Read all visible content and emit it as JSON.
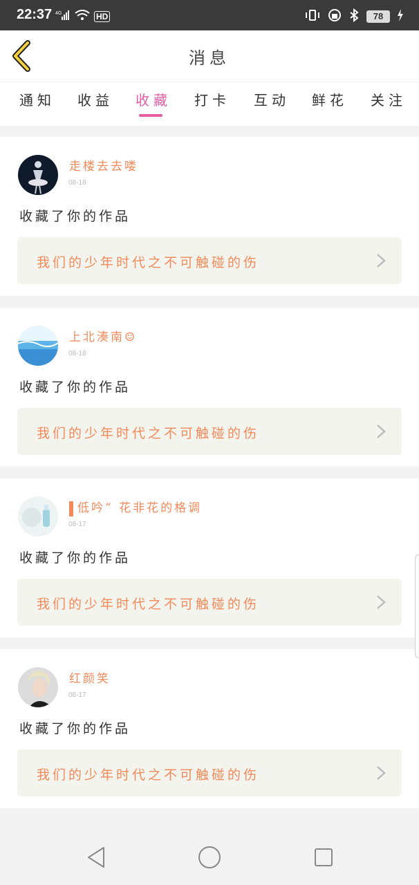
{
  "status": {
    "time": "22:37",
    "network": "4G",
    "hd": "HD",
    "battery": "78"
  },
  "header": {
    "title": "消息",
    "back_icon": "chevron-left-icon"
  },
  "tabs": [
    {
      "label": "通知",
      "active": false
    },
    {
      "label": "收益",
      "active": false
    },
    {
      "label": "收藏",
      "active": true
    },
    {
      "label": "打卡",
      "active": false
    },
    {
      "label": "互动",
      "active": false
    },
    {
      "label": "鲜花",
      "active": false
    },
    {
      "label": "关注",
      "active": false
    }
  ],
  "colors": {
    "accent": "#e55ea0",
    "name": "#f28a5a",
    "work_bg": "#f4f4ee"
  },
  "items": [
    {
      "name": "走楼去去喽",
      "date": "08-18",
      "action": "收藏了你的作品",
      "work": "我们的少年时代之不可触碰的伤"
    },
    {
      "name": "上北湊南☺",
      "date": "08-18",
      "action": "收藏了你的作品",
      "work": "我们的少年时代之不可触碰的伤"
    },
    {
      "name": "低吟” 花非花的格调",
      "date": "08-17",
      "action": "收藏了你的作品",
      "work": "我们的少年时代之不可触碰的伤"
    },
    {
      "name": "红颜笑",
      "date": "08-17",
      "action": "收藏了你的作品",
      "work": "我们的少年时代之不可触碰的伤"
    }
  ]
}
